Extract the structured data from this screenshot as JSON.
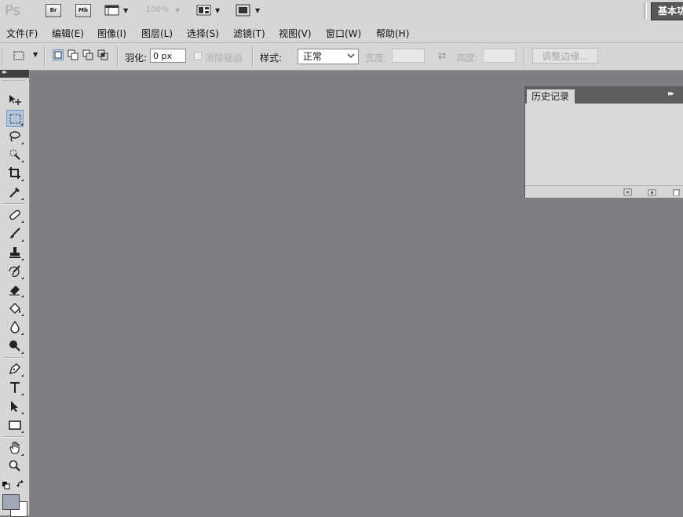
{
  "app": {
    "logo": "Ps",
    "bridge_label": "Br",
    "minibridge_label": "Mb",
    "zoom": "100%",
    "workspace": "基本功能"
  },
  "menu": [
    "文件(F)",
    "编辑(E)",
    "图像(I)",
    "图层(L)",
    "选择(S)",
    "滤镜(T)",
    "视图(V)",
    "窗口(W)",
    "帮助(H)"
  ],
  "options": {
    "feather_label": "羽化:",
    "feather_value": "0 px",
    "antialias_label": "消除锯齿",
    "style_label": "样式:",
    "style_value": "正常",
    "width_label": "宽度:",
    "height_label": "高度:",
    "refine_edge_label": "调整边缘..."
  },
  "history_panel": {
    "title": "历史记录"
  },
  "colors": {
    "canvas": "#7f7e82",
    "chrome": "#d6d6d6",
    "foreground": "#9ea9b8",
    "background": "#ffffff",
    "active_tool": "#b3c7e0"
  },
  "tools": [
    "move-tool",
    "rectangular-marquee-tool",
    "lasso-tool",
    "quick-selection-tool",
    "crop-tool",
    "eyedropper-tool",
    "spot-healing-tool",
    "brush-tool",
    "clone-stamp-tool",
    "history-brush-tool",
    "eraser-tool",
    "paint-bucket-tool",
    "blur-tool",
    "dodge-tool",
    "pen-tool",
    "type-tool",
    "path-selection-tool",
    "rectangle-tool",
    "hand-tool",
    "zoom-tool"
  ]
}
